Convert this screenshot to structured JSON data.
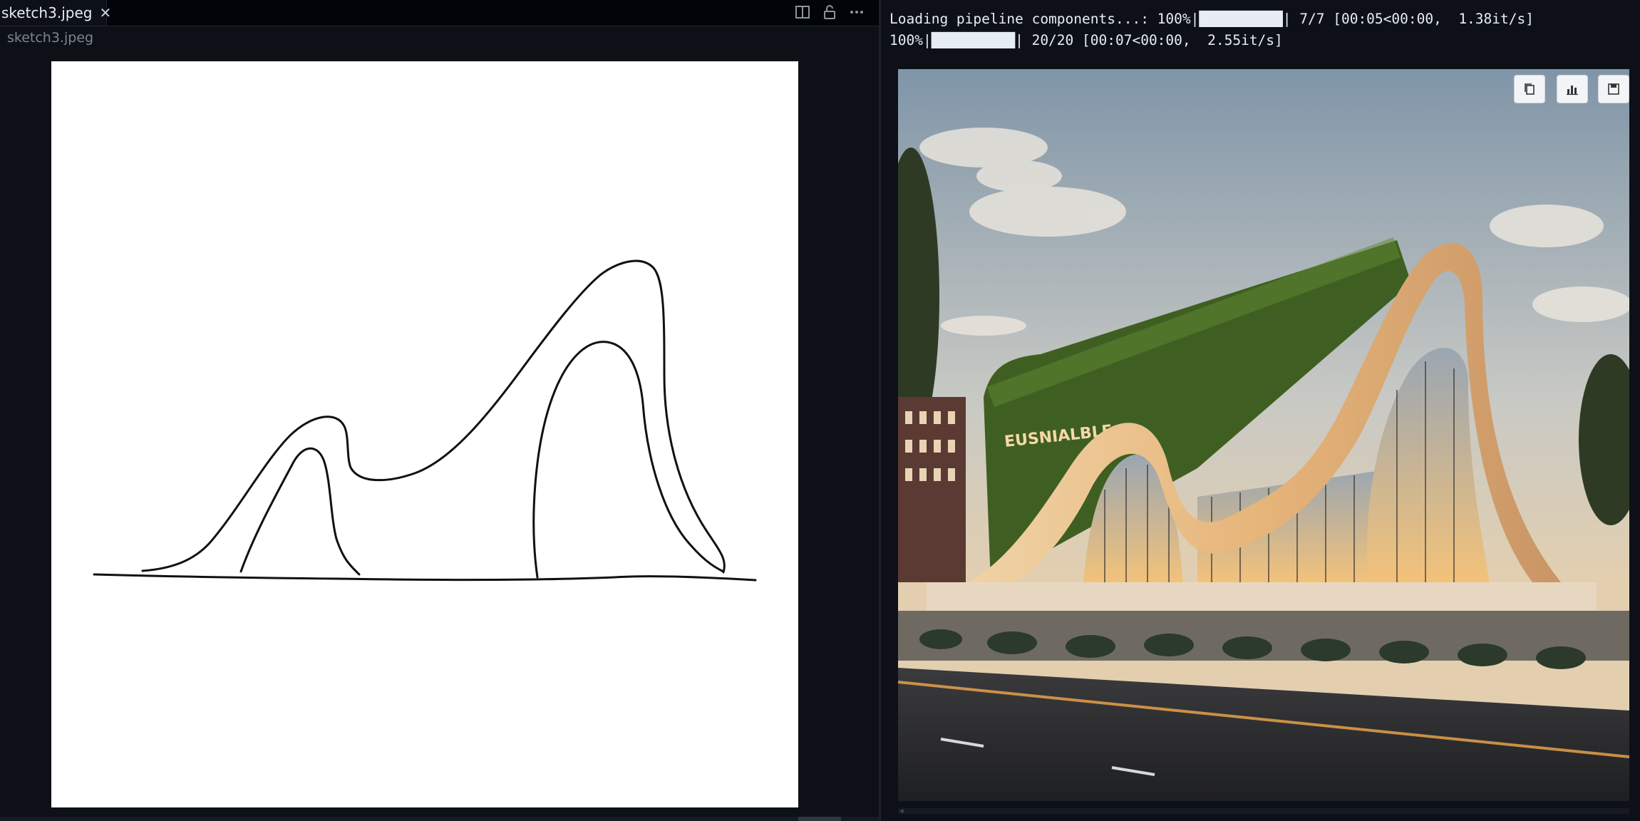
{
  "editor": {
    "tab_title": "sketch3.jpeg",
    "close_glyph": "✕",
    "breadcrumb": "sketch3.jpeg",
    "actions": [
      "split-editor-icon",
      "lock-icon",
      "more-icon"
    ]
  },
  "output": {
    "log_lines": [
      "Loading pipeline components...: 100%|██████████| 7/7 [00:05<00:00,  1.38it/s]",
      "100%|██████████| 20/20 [00:07<00:00,  2.55it/s]"
    ],
    "image_sign_text": "EUSNIALBLE",
    "image_buttons": [
      "copy-icon",
      "chart-icon",
      "save-icon"
    ]
  },
  "colors": {
    "background": "#0d1117",
    "tab_strip": "#010409",
    "sketch_paper": "#ffffff"
  }
}
